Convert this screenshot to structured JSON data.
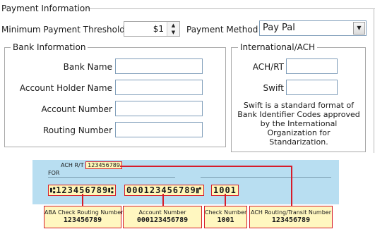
{
  "payment": {
    "legend": "Payment Information",
    "min_threshold_label": "Minimum Payment Threshold",
    "min_threshold_value": "$1",
    "method_label": "Payment Method",
    "method_value": "Pay Pal"
  },
  "bank": {
    "legend": "Bank Information",
    "fields": {
      "bank_name": "Bank Name",
      "account_holder": "Account Holder Name",
      "account_number": "Account Number",
      "routing_number": "Routing Number"
    }
  },
  "intl": {
    "legend": "International/ACH",
    "achrt_label": "ACH/RT",
    "swift_label": "Swift",
    "note": "Swift is a standard format of Bank Identifier Codes approved by the International Organization for Standarization."
  },
  "check": {
    "achrt_prefix": "ACH R/T",
    "achrt_value": "123456789",
    "for_label": "FOR",
    "micr_routing": "⑆123456789⑆",
    "micr_account": "000123456789⑈",
    "micr_check": "1001",
    "callouts": {
      "aba_title": "ABA Check Routing Number",
      "aba_value": "123456789",
      "account_title": "Account Number",
      "account_value": "000123456789",
      "check_title": "Check Number",
      "check_value": "1001",
      "ach_title": "ACH Routing/Transit Number",
      "ach_value": "123456789"
    }
  }
}
